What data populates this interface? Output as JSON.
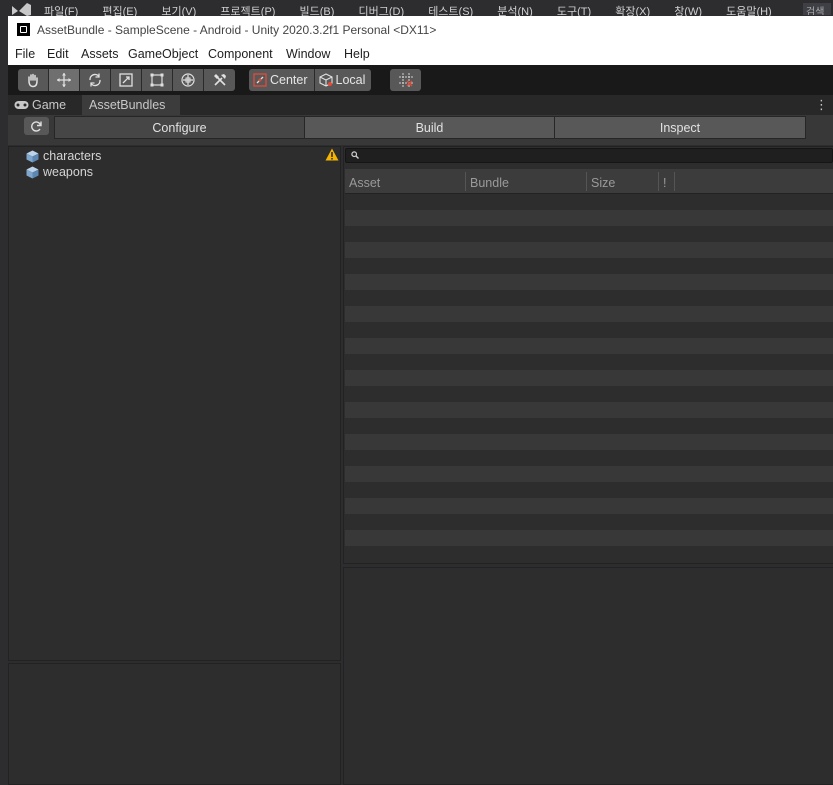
{
  "host": {
    "menu": [
      "파일(F)",
      "편집(E)",
      "보기(V)",
      "프로젝트(P)",
      "빌드(B)",
      "디버그(D)",
      "테스트(S)",
      "분석(N)",
      "도구(T)",
      "확장(X)",
      "창(W)",
      "도움말(H)"
    ],
    "search_label": "검색"
  },
  "window": {
    "title": "AssetBundle - SampleScene - Android - Unity 2020.3.2f1 Personal <DX11>"
  },
  "menubar": [
    "File",
    "Edit",
    "Assets",
    "GameObject",
    "Component",
    "Window",
    "Help"
  ],
  "toolbar": {
    "tools": [
      "hand-tool-icon",
      "move-tool-icon",
      "rotate-tool-icon",
      "scale-tool-icon",
      "rect-tool-icon",
      "transform-tool-icon",
      "custom-tool-icon"
    ],
    "active_tool": "move-tool-icon",
    "pivot_mode": "Center",
    "pivot_rotation": "Local"
  },
  "tabs": [
    {
      "label": "Game",
      "icon": "gamepad-icon",
      "active": false
    },
    {
      "label": "AssetBundles",
      "active": true
    }
  ],
  "modes": {
    "items": [
      "Configure",
      "Build",
      "Inspect"
    ],
    "selected": "Configure"
  },
  "bundles": [
    {
      "name": "characters",
      "icon": "bundle-cube-icon"
    },
    {
      "name": "weapons",
      "icon": "bundle-cube-icon"
    }
  ],
  "warning_icon": "warning-icon",
  "asset_list": {
    "search_value": "",
    "columns": [
      "Asset",
      "Bundle",
      "Size",
      "!"
    ],
    "rows": []
  },
  "colors": {
    "background": "#2d2d2d",
    "toolbar": "#191919",
    "button": "#585858",
    "selected_mode": "#464646",
    "warning": "#f4b400"
  }
}
